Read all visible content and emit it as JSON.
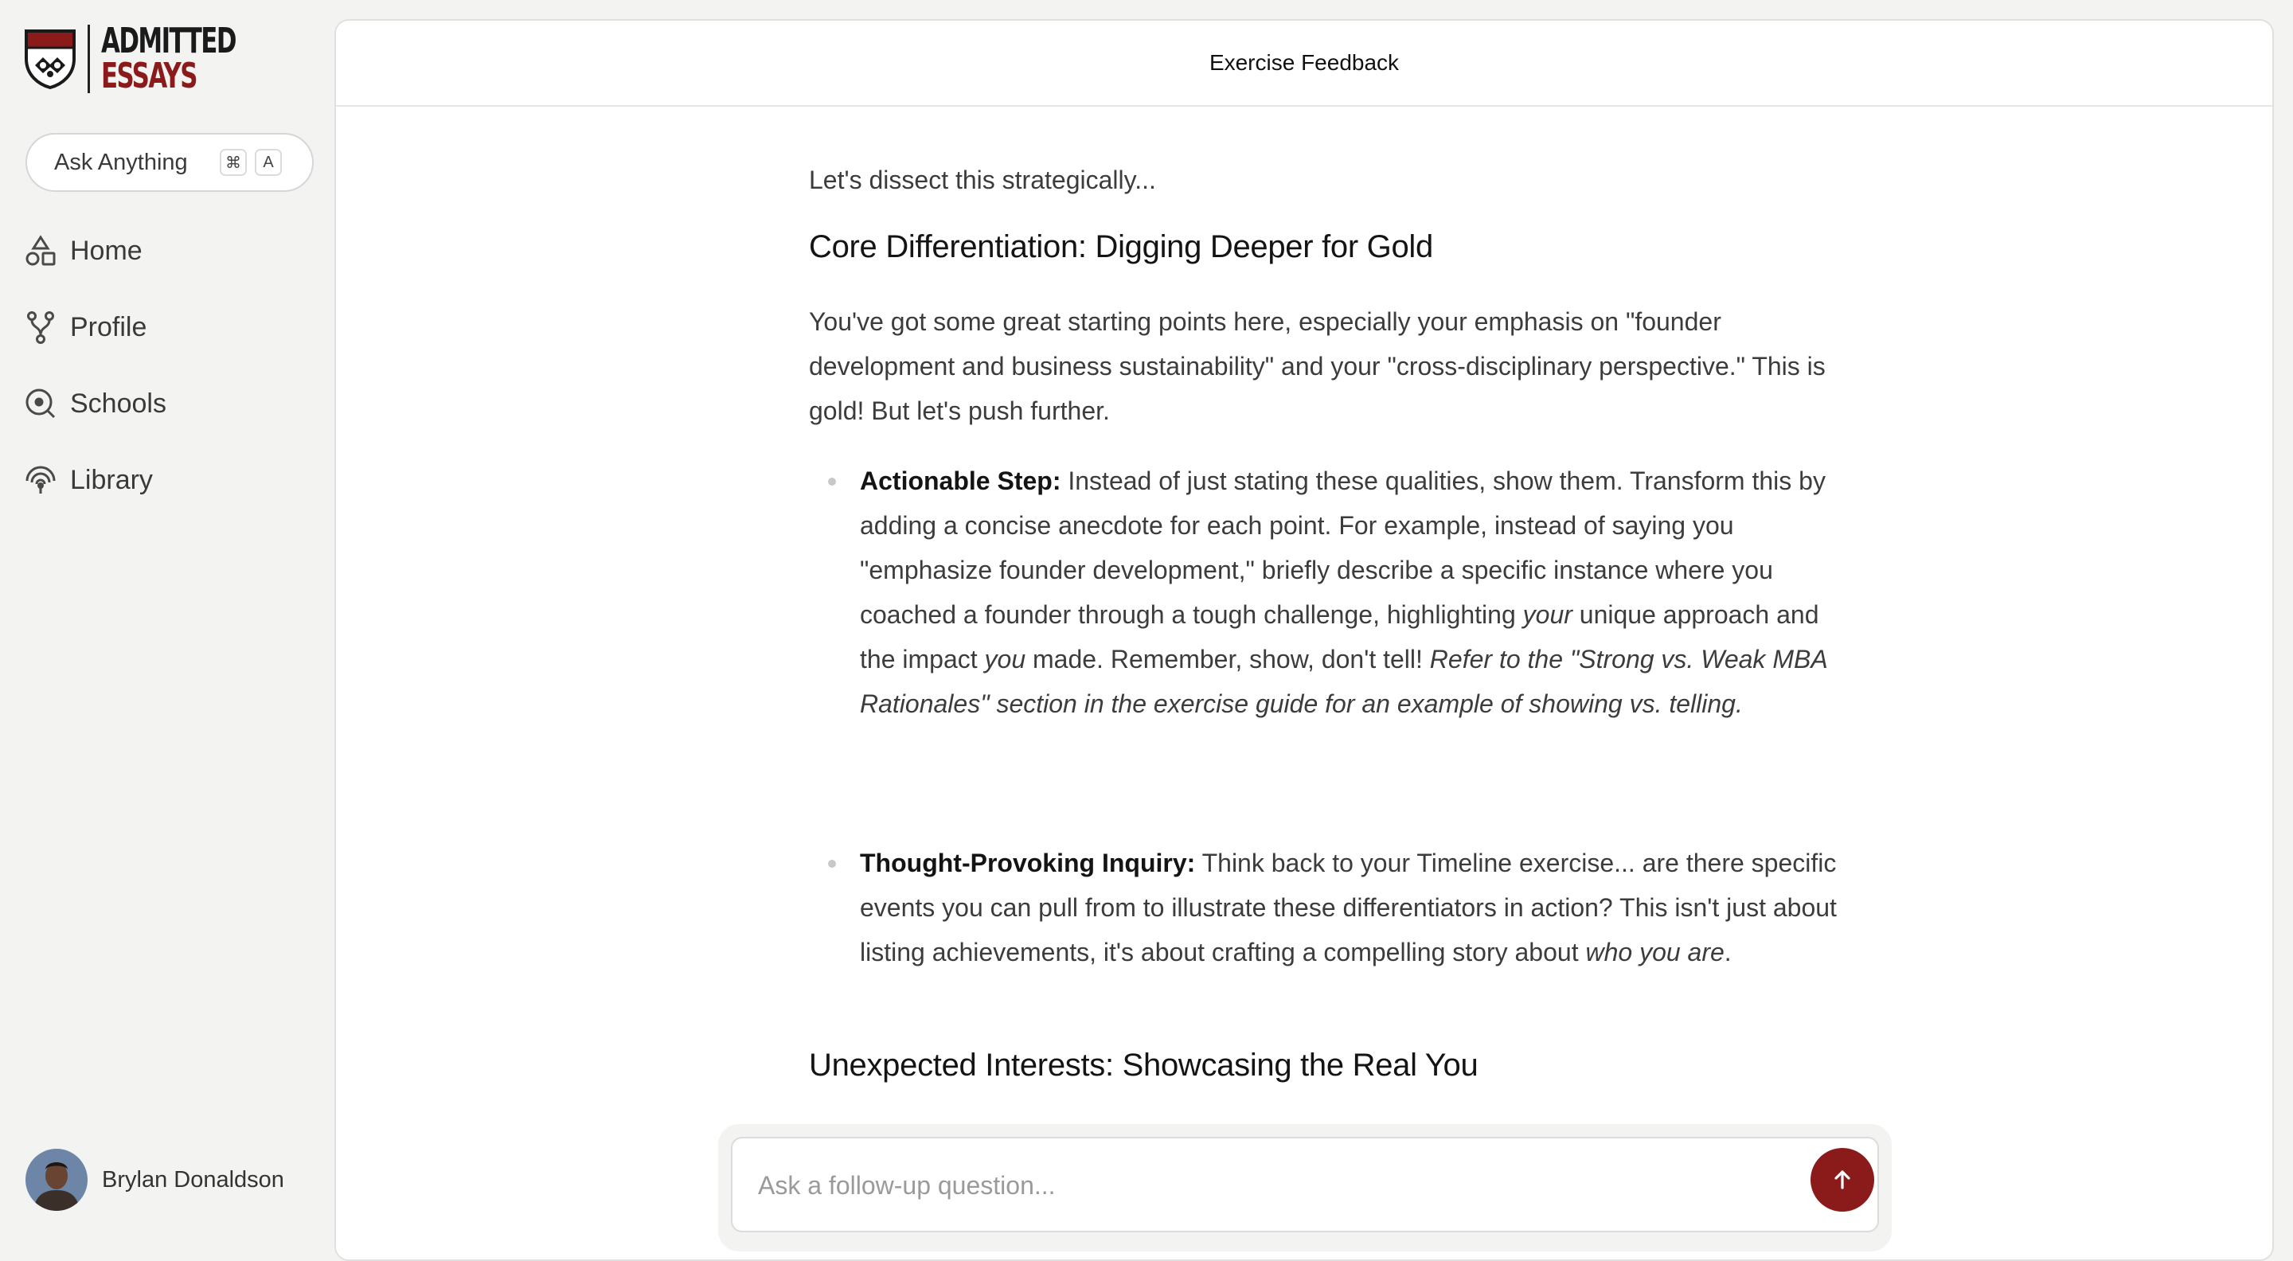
{
  "brand": {
    "line1": "ADMITTED",
    "line2": "ESSAYS"
  },
  "sidebar": {
    "ask": {
      "label": "Ask Anything",
      "key1": "⌘",
      "key2": "A"
    },
    "items": [
      {
        "label": "Home",
        "icon": "shapes-icon"
      },
      {
        "label": "Profile",
        "icon": "branch-icon"
      },
      {
        "label": "Schools",
        "icon": "search-circle-icon"
      },
      {
        "label": "Library",
        "icon": "signal-icon"
      }
    ],
    "user": {
      "name": "Brylan Donaldson"
    }
  },
  "main": {
    "title": "Exercise Feedback",
    "intro": "Let's dissect this strategically...",
    "section1": {
      "heading": "Core Differentiation: Digging Deeper for Gold",
      "para": "You've got some great starting points here, especially your emphasis on \"founder development and business sustainability\" and your \"cross-disciplinary perspective.\" This is gold! But let's push further.",
      "bullet1": {
        "label": "Actionable Step:",
        "t1": " Instead of just stating these qualities, show them. Transform this by adding a concise anecdote for each point. For example, instead of saying you \"emphasize founder development,\" briefly describe a specific instance where you coached a founder through a tough challenge, highlighting ",
        "em1": "your",
        "t2": " unique approach and the impact ",
        "em2": "you",
        "t3": " made. Remember, show, don't tell! ",
        "em3": "Refer to the \"Strong vs. Weak MBA Rationales\" section in the exercise guide for an example of showing vs. telling."
      },
      "bullet2": {
        "label": "Thought-Provoking Inquiry:",
        "t1": " Think back to your Timeline exercise... are there specific events you can pull from to illustrate these differentiators in action? This isn't just about listing achievements, it's about crafting a compelling story about ",
        "em1": "who you are",
        "t2": "."
      }
    },
    "section2": {
      "heading": "Unexpected Interests: Showcasing the Real You"
    },
    "followup": {
      "placeholder": "Ask a follow-up question..."
    }
  },
  "colors": {
    "accent": "#8b1a1a",
    "background": "#f3f3f2",
    "panel": "#ffffff"
  }
}
